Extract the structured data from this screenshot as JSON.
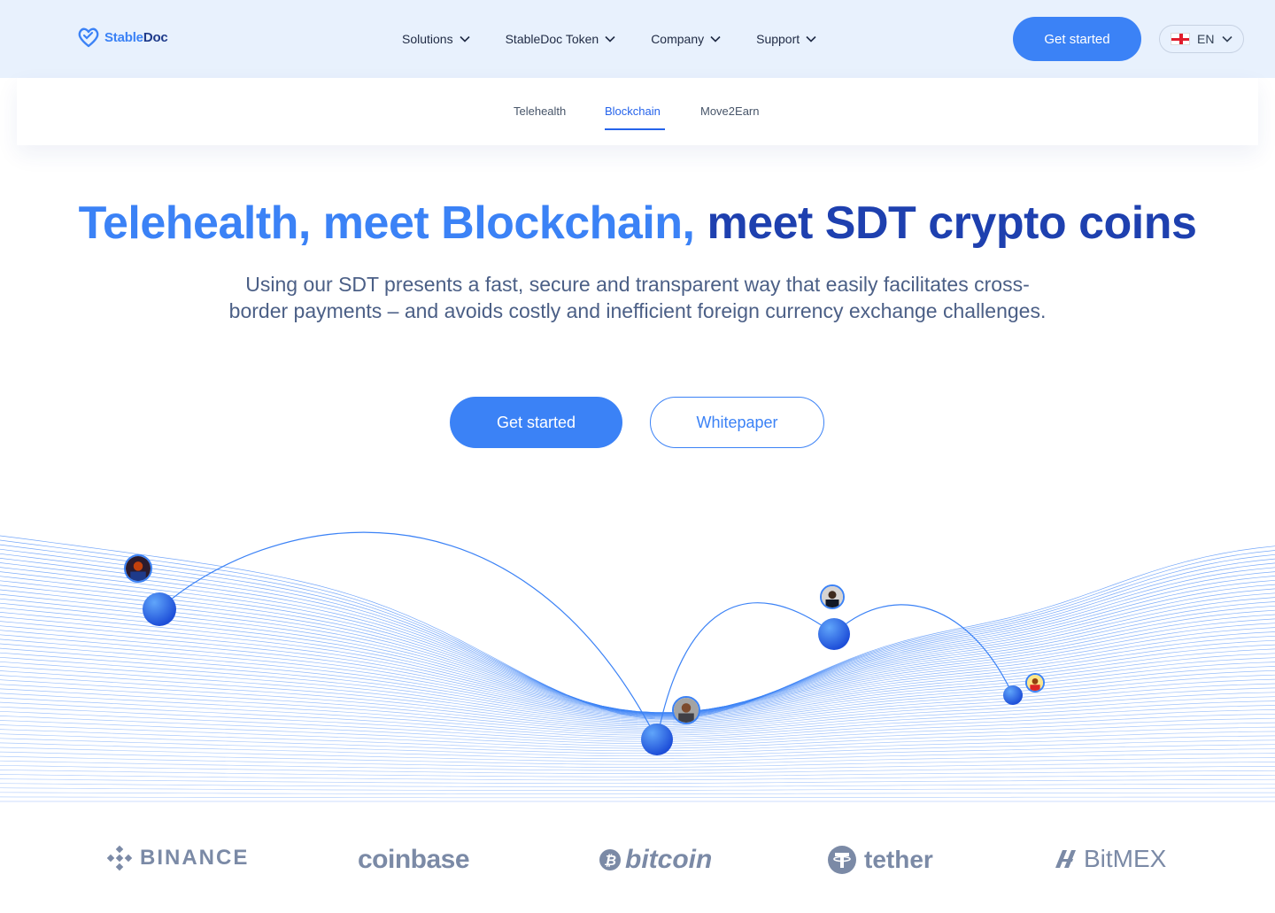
{
  "brand": {
    "part1": "Stable",
    "part2": "Doc"
  },
  "nav": {
    "items": [
      {
        "label": "Solutions"
      },
      {
        "label": "StableDoc Token"
      },
      {
        "label": "Company"
      },
      {
        "label": "Support"
      }
    ],
    "cta": "Get started",
    "language": "EN"
  },
  "subnav": {
    "tabs": [
      {
        "label": "Telehealth",
        "active": false
      },
      {
        "label": "Blockchain",
        "active": true
      },
      {
        "label": "Move2Earn",
        "active": false
      }
    ]
  },
  "hero": {
    "title_part1": "Telehealth, meet Blockchain,",
    "title_part2": "meet SDT crypto coins",
    "subtitle": "Using our SDT presents a fast, secure and transparent way that easily facilitates cross-border payments – and avoids costly and inefficient foreign currency exchange challenges.",
    "primary_button": "Get started",
    "secondary_button": "Whitepaper"
  },
  "partners": [
    {
      "name": "BINANCE",
      "icon": "binance-icon"
    },
    {
      "name": "coinbase",
      "icon": null
    },
    {
      "name": "bitcoin",
      "icon": "bitcoin-icon"
    },
    {
      "name": "tether",
      "icon": "tether-icon"
    },
    {
      "name": "BitMEX",
      "icon": "bitmex-icon"
    }
  ],
  "colors": {
    "accent": "#3b82f6",
    "navy": "#1e3a8a",
    "header_bg": "#e8f1fd",
    "partner_gray": "#7b8aa6"
  }
}
